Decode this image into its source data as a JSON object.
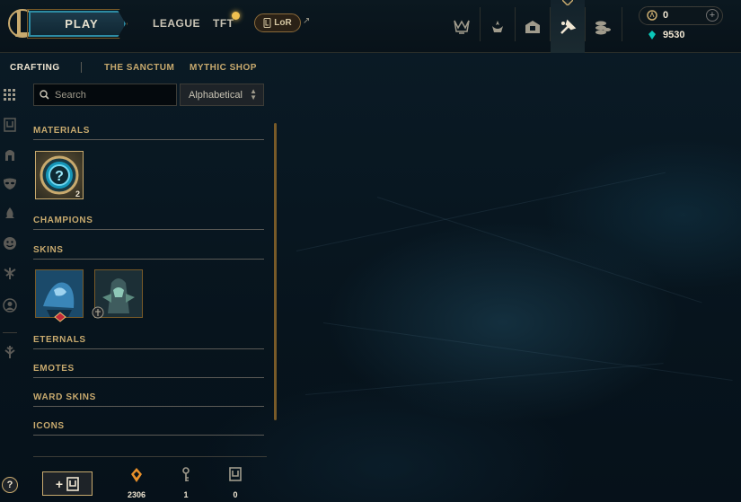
{
  "header": {
    "play_label": "PLAY",
    "nav": [
      "LEAGUE",
      "TFT"
    ],
    "lor_label": "LoR",
    "icons": [
      "ranked-icon",
      "challenges-icon",
      "profile-icon",
      "crafting-icon",
      "store-icon"
    ],
    "currency": {
      "rp": "0",
      "blue_essence": "9530"
    }
  },
  "subnav": {
    "crafting": "CRAFTING",
    "sanctum": "THE SANCTUM",
    "mythic_shop": "MYTHIC SHOP"
  },
  "filters": {
    "search_placeholder": "Search",
    "sort_value": "Alphabetical"
  },
  "sections": {
    "materials": "MATERIALS",
    "champions": "CHAMPIONS",
    "skins": "SKINS",
    "eternals": "ETERNALS",
    "emotes": "EMOTES",
    "ward_skins": "WARD SKINS",
    "icons": "ICONS"
  },
  "materials": [
    {
      "name": "mystery-orb",
      "count": "2"
    }
  ],
  "skins": [
    {
      "name": "skin-shard-1"
    },
    {
      "name": "skin-shard-2"
    }
  ],
  "footer": {
    "open_label": "+",
    "resources": [
      {
        "name": "orange-essence",
        "value": "2306"
      },
      {
        "name": "key",
        "value": "1"
      },
      {
        "name": "chest",
        "value": "0"
      }
    ]
  },
  "colors": {
    "gold": "#c8aa6e",
    "blue": "#0ac8b9",
    "dark": "#06121b"
  }
}
